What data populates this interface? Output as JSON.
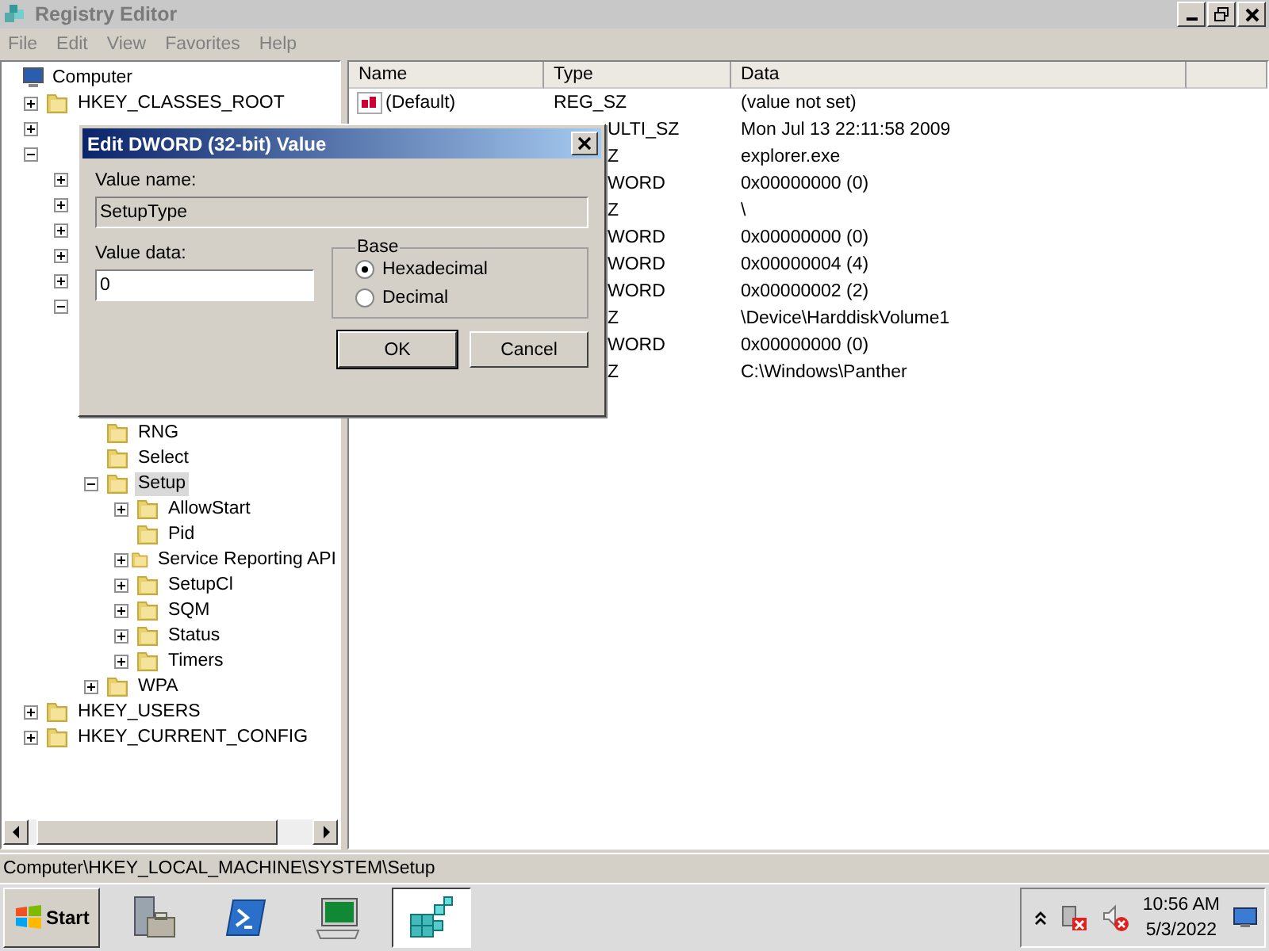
{
  "window": {
    "title": "Registry Editor"
  },
  "menu": [
    {
      "label": "File"
    },
    {
      "label": "Edit"
    },
    {
      "label": "View"
    },
    {
      "label": "Favorites"
    },
    {
      "label": "Help"
    }
  ],
  "tree": [
    {
      "label": "Computer",
      "kind": "computer",
      "selected": false,
      "children": [
        {
          "label": "HKEY_CLASSES_ROOT",
          "selected": false,
          "expanded": false
        },
        {
          "expanded": false
        },
        {
          "expanded": true,
          "children": [
            {
              "expanded": false
            },
            {
              "expanded": false
            },
            {
              "expanded": false
            },
            {
              "expanded": false
            },
            {
              "expanded": false
            },
            {
              "expanded": true,
              "children": [
                {
                  "kind": "covered"
                },
                {
                  "kind": "covered"
                },
                {
                  "kind": "covered"
                },
                {
                  "kind": "covered"
                },
                {
                  "label": "RNG",
                  "selected": false
                },
                {
                  "label": "Select",
                  "selected": false
                },
                {
                  "label": "Setup",
                  "selected": true,
                  "expanded": true,
                  "children": [
                    {
                      "label": "AllowStart",
                      "selected": false,
                      "expanded": false
                    },
                    {
                      "label": "Pid",
                      "selected": false
                    },
                    {
                      "label": "Service Reporting API",
                      "selected": false,
                      "expanded": false
                    },
                    {
                      "label": "SetupCl",
                      "selected": false,
                      "expanded": false
                    },
                    {
                      "label": "SQM",
                      "selected": false,
                      "expanded": false
                    },
                    {
                      "label": "Status",
                      "selected": false,
                      "expanded": false
                    },
                    {
                      "label": "Timers",
                      "selected": false,
                      "expanded": false
                    }
                  ]
                },
                {
                  "label": "WPA",
                  "selected": false,
                  "expanded": false
                }
              ]
            }
          ]
        },
        {
          "label": "HKEY_USERS",
          "selected": false,
          "expanded": false
        },
        {
          "label": "HKEY_CURRENT_CONFIG",
          "selected": false,
          "expanded": false
        }
      ]
    }
  ],
  "table": {
    "columns": [
      "Name",
      "Type",
      "Data"
    ],
    "rows": [
      {
        "name": "(Default)",
        "type": "REG_SZ",
        "data": "(value not set)"
      },
      {
        "type": "ULTI_SZ",
        "data": "Mon Jul 13 22:11:58 2009"
      },
      {
        "type": "Z",
        "data": "explorer.exe"
      },
      {
        "type": "WORD",
        "data": "0x00000000 (0)"
      },
      {
        "type": "Z",
        "data": "\\"
      },
      {
        "type": "WORD",
        "data": "0x00000000 (0)"
      },
      {
        "type": "WORD",
        "data": "0x00000004 (4)"
      },
      {
        "type": "WORD",
        "data": "0x00000002 (2)"
      },
      {
        "type": "Z",
        "data": "\\Device\\HarddiskVolume1"
      },
      {
        "type": "WORD",
        "data": "0x00000000 (0)"
      },
      {
        "type": "Z",
        "data": "C:\\Windows\\Panther"
      }
    ]
  },
  "status_bar": "Computer\\HKEY_LOCAL_MACHINE\\SYSTEM\\Setup",
  "dialog": {
    "title": "Edit DWORD (32-bit) Value",
    "value_name_label": "Value name:",
    "value_name": "SetupType",
    "value_data_label": "Value data:",
    "value_data": "0",
    "base_label": "Base",
    "bases": [
      {
        "label": "Hexadecimal",
        "selected": true
      },
      {
        "label": "Decimal",
        "selected": false
      }
    ],
    "buttons": [
      {
        "label": "OK",
        "default": true
      },
      {
        "label": "Cancel",
        "default": false
      }
    ]
  },
  "taskbar": {
    "start": "Start",
    "apps": [
      {
        "kind": "server",
        "selected": false
      },
      {
        "kind": "shell",
        "selected": false
      },
      {
        "kind": "monitor",
        "selected": false
      },
      {
        "kind": "registry",
        "selected": true
      }
    ],
    "time": "10:56 AM",
    "date": "5/3/2022"
  }
}
